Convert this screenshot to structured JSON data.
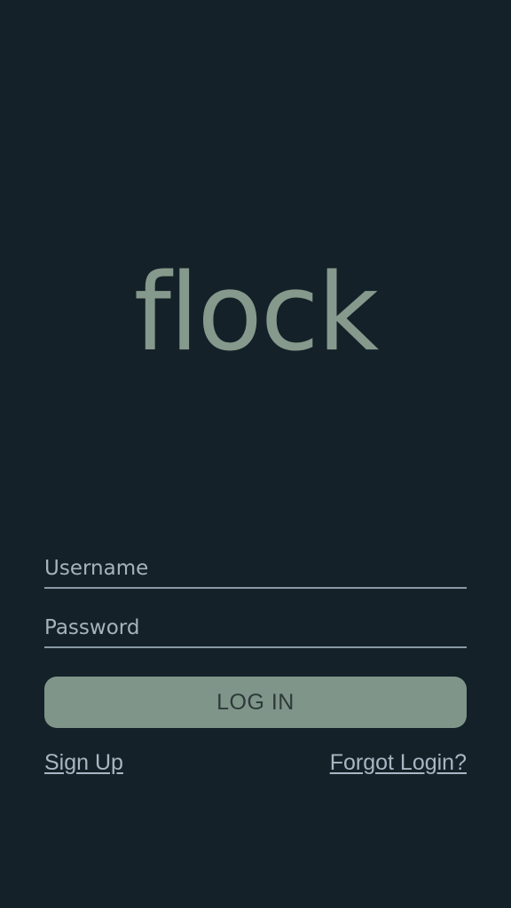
{
  "app": {
    "logo_text": "flock"
  },
  "form": {
    "username_placeholder": "Username",
    "password_placeholder": "Password",
    "username_value": "",
    "password_value": "",
    "login_label": "LOG IN"
  },
  "links": {
    "sign_up": "Sign Up",
    "forgot_login": "Forgot Login?"
  },
  "colors": {
    "background": "#152128",
    "accent": "#7f958a",
    "logo": "#85998c",
    "link": "#a9b6c2"
  }
}
